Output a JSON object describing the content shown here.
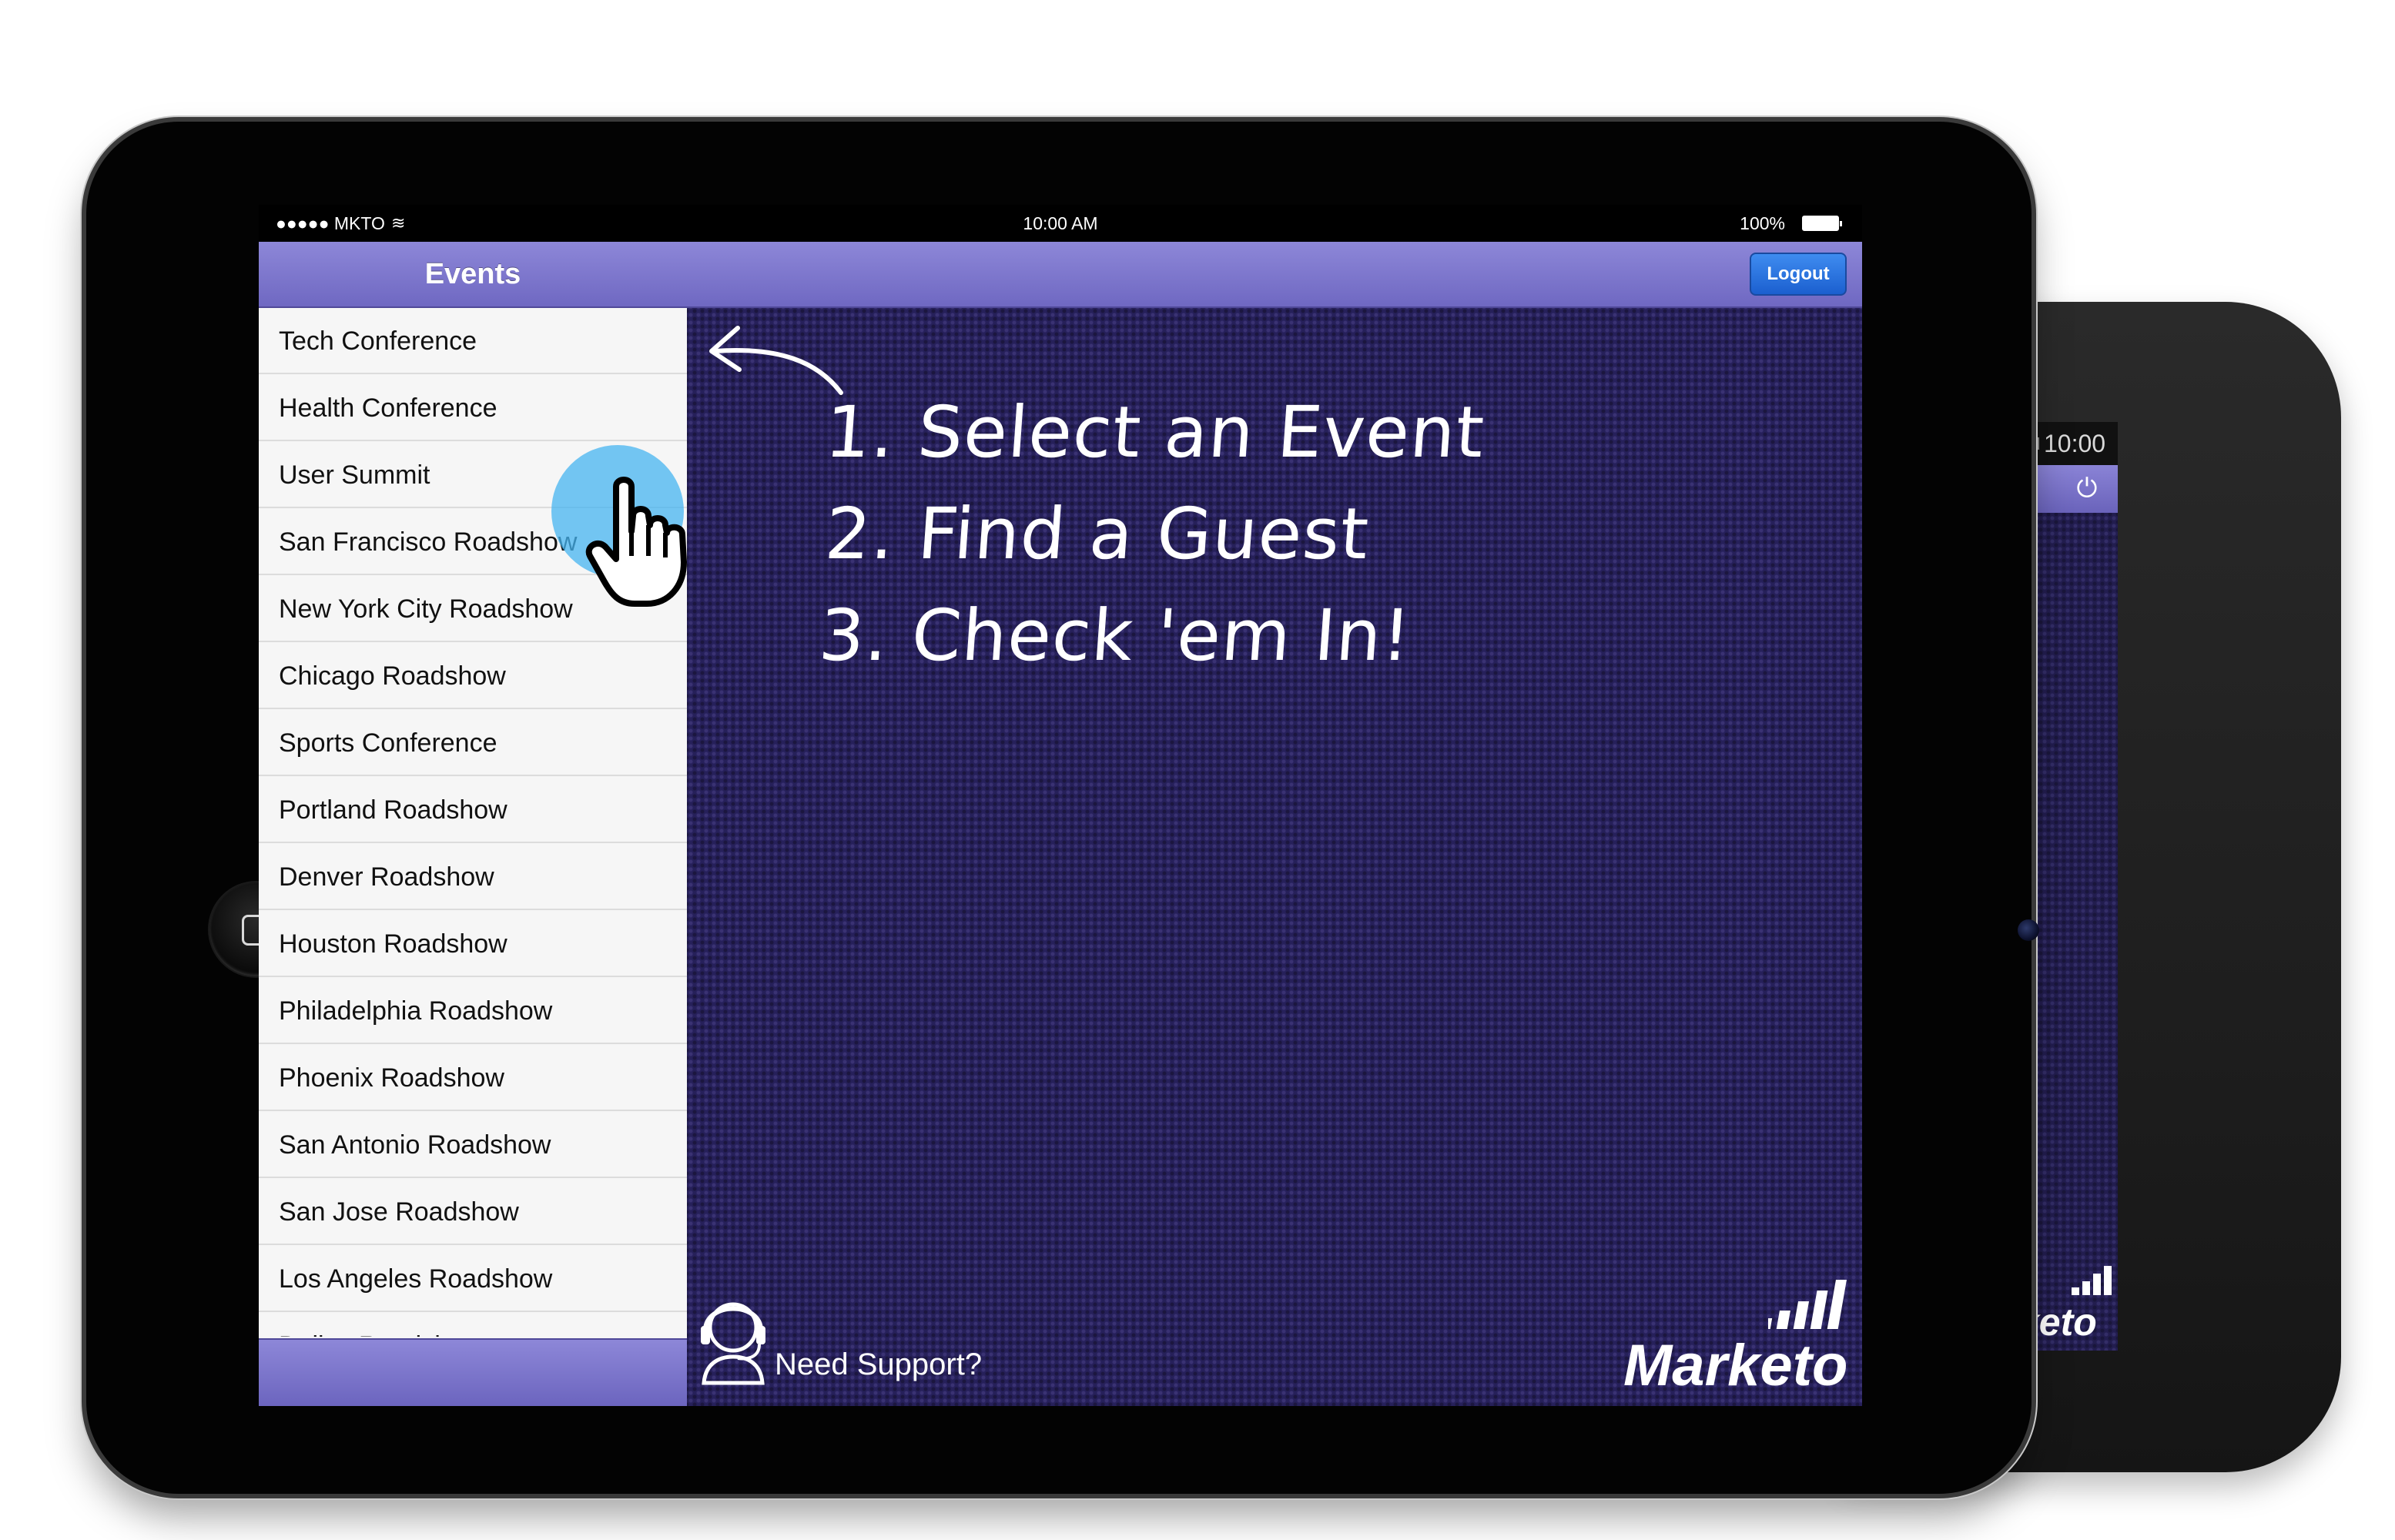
{
  "colors": {
    "header_gradient_top": "#8d87d8",
    "header_gradient_bottom": "#6f68c2",
    "main_background": "#26205a",
    "list_background": "#f6f6f6",
    "logout_button": "#2a72e0",
    "tap_indicator": "#46b4f0"
  },
  "status_bar": {
    "carrier": "●●●●● MKTO",
    "wifi_icon": "wifi-icon",
    "time": "10:00 AM",
    "battery": "100%"
  },
  "sidebar": {
    "title": "Events",
    "events": [
      {
        "label": "Tech Conference"
      },
      {
        "label": "Health Conference"
      },
      {
        "label": "User Summit"
      },
      {
        "label": "San Francisco Roadshow"
      },
      {
        "label": "New York City Roadshow"
      },
      {
        "label": "Chicago Roadshow"
      },
      {
        "label": "Sports Conference"
      },
      {
        "label": "Portland Roadshow"
      },
      {
        "label": "Denver Roadshow"
      },
      {
        "label": "Houston Roadshow"
      },
      {
        "label": "Philadelphia Roadshow"
      },
      {
        "label": "Phoenix Roadshow"
      },
      {
        "label": "San Antonio Roadshow"
      },
      {
        "label": "San Jose Roadshow"
      },
      {
        "label": "Los Angeles Roadshow"
      },
      {
        "label": "Dallas Roadshow"
      }
    ]
  },
  "header": {
    "logout_label": "Logout"
  },
  "instructions": {
    "step_1": "1. Select an Event",
    "step_2": "2. Find a Guest",
    "step_3": "3. Check 'em In!"
  },
  "footer": {
    "support_label": "Need Support?",
    "brand": "Marketo"
  },
  "back_device": {
    "time": "10:00",
    "brand_partial": "keto"
  }
}
